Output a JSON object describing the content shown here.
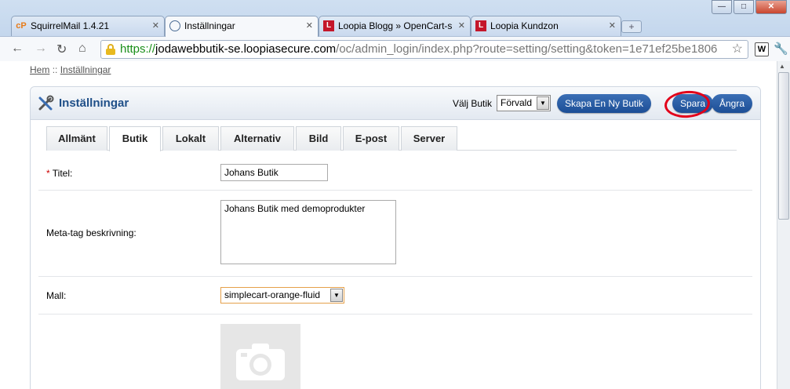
{
  "browser": {
    "tabs": [
      {
        "label": "SquirrelMail 1.4.21",
        "favicon": "cp"
      },
      {
        "label": "Inställningar",
        "favicon": "globe"
      },
      {
        "label": "Loopia Blogg » OpenCart-s",
        "favicon": "L"
      },
      {
        "label": "Loopia Kundzon",
        "favicon": "L"
      }
    ],
    "url": {
      "scheme": "https://",
      "host": "jodawebbutik-se.loopiasecure.com",
      "path": "/oc/admin_login/index.php?route=setting/setting&token=1e71ef25be1806"
    },
    "extension_label": "W"
  },
  "breadcrumb": {
    "home": "Hem",
    "separator": "::",
    "current": "Inställningar"
  },
  "header": {
    "title": "Inställningar",
    "store_label": "Välj Butik",
    "store_value": "Förvald",
    "create_store": "Skapa En Ny Butik",
    "save": "Spara",
    "cancel": "Ångra"
  },
  "tabs": [
    "Allmänt",
    "Butik",
    "Lokalt",
    "Alternativ",
    "Bild",
    "E-post",
    "Server"
  ],
  "form": {
    "title_required": "*",
    "title_label": "Titel:",
    "title_value": "Johans Butik",
    "meta_label": "Meta-tag beskrivning:",
    "meta_value": "Johans Butik med demoprodukter",
    "template_label": "Mall:",
    "template_value": "simplecart-orange-fluid"
  },
  "colors": {
    "accent": "#1c4e96",
    "highlight_circle": "#e2001a",
    "title": "#1f4f88"
  }
}
